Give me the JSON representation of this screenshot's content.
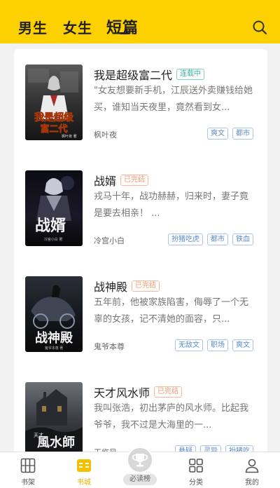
{
  "header": {
    "tabs": [
      {
        "label": "男生"
      },
      {
        "label": "女生"
      },
      {
        "label": "短篇"
      }
    ]
  },
  "books": [
    {
      "title": "我是超级富二代",
      "status": "连载中",
      "status_type": "ongoing",
      "description": "\"女友想要新手机，江辰送外卖赚钱给她买，谁知当天夜里，竟然看到女...",
      "author": "枫叶夜",
      "tags": [
        "爽文",
        "都市"
      ],
      "cover_text": "我是超级富二代",
      "cover_subtext": "枫叶夜  著"
    },
    {
      "title": "战婿",
      "status": "已完结",
      "status_type": "done",
      "description": "戎马十年，战功赫赫，归来时，妻子竟是要去相亲！ ...",
      "author": "冷宫小白",
      "tags": [
        "扮猪吃虎",
        "都市",
        "铁血"
      ],
      "cover_text": "战婿",
      "cover_subtext": "冷宫小白  著"
    },
    {
      "title": "战神殿",
      "status": "已完结",
      "status_type": "done",
      "description": "五年前，他被家族陷害，侮辱了一个无辜的女孩，记不清她的面容，只...",
      "author": "鬼爷本尊",
      "tags": [
        "无敌文",
        "职场",
        "爽文"
      ],
      "cover_text": "战神殿",
      "cover_subtext": "鬼爷本尊 著"
    },
    {
      "title": "天才风水师",
      "status": "已完结",
      "status_type": "done",
      "description": "我叫张浩，初出茅庐的风水师。比起我爷爷，我不过是大海里的一...",
      "author": "王临风",
      "tags": [
        "悬疑",
        "灵异",
        "扮猪吃"
      ],
      "cover_text": "风水师",
      "cover_subtext": "天才"
    }
  ],
  "tabbar": {
    "items": [
      {
        "label": "书架",
        "icon": "bookshelf-icon"
      },
      {
        "label": "书城",
        "icon": "bookstore-icon"
      },
      {
        "label": "必读榜",
        "icon": "trophy-icon"
      },
      {
        "label": "分类",
        "icon": "category-icon"
      },
      {
        "label": "我的",
        "icon": "profile-icon"
      }
    ]
  },
  "colors": {
    "brand_yellow": "#fdd000",
    "active_tab": "#e4b300",
    "ongoing": "#3cb1a1",
    "done": "#ee9a72",
    "tag": "#5b8ac9"
  }
}
